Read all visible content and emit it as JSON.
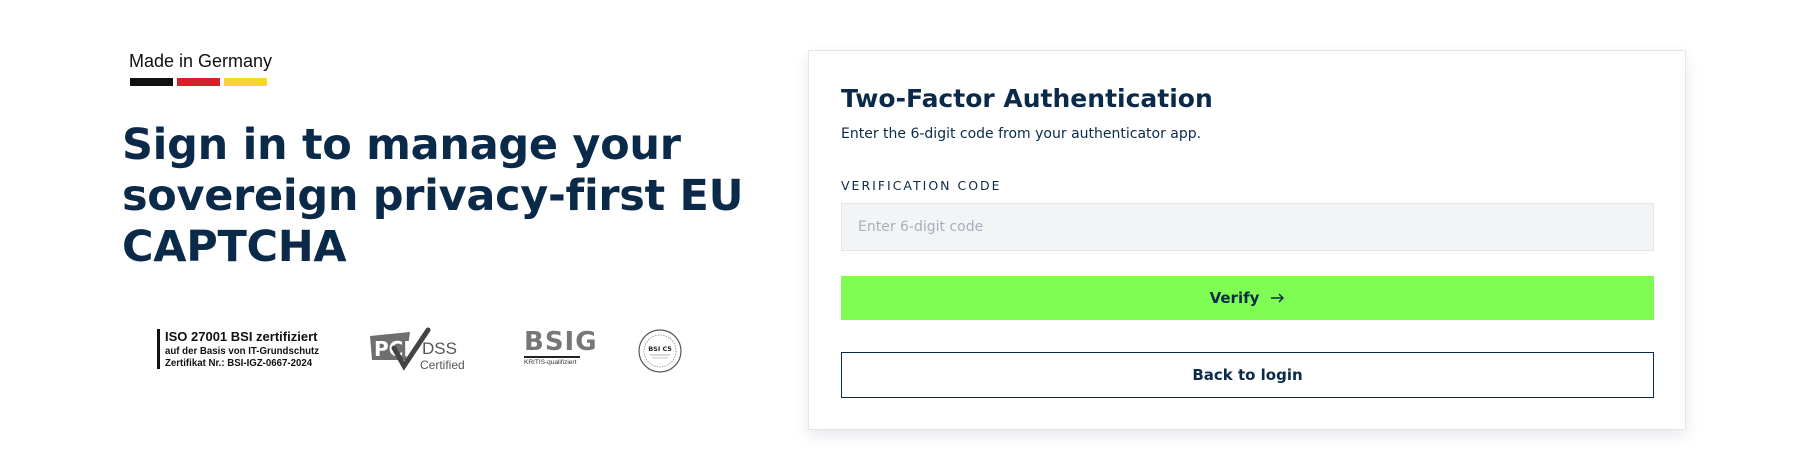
{
  "branding": {
    "made_in_label": "Made in Germany",
    "flag_colors": [
      "#111111",
      "#d2232a",
      "#f7d633"
    ]
  },
  "hero": {
    "headline": "Sign in to manage your sovereign privacy-first EU CAPTCHA"
  },
  "certifications": {
    "iso": {
      "line1": "ISO 27001 BSI zertifiziert",
      "line2": "auf der Basis von IT-Grundschutz",
      "line3": "Zertifikat Nr.: BSI-IGZ-0667-2024"
    },
    "pci": {
      "brand": "PCI",
      "dss": "DSS",
      "label": "Certified"
    },
    "bsig": {
      "letters": "BSIG",
      "sub": "KRITIS-qualifiziert"
    },
    "seal": {
      "label": "BSI C5"
    }
  },
  "card": {
    "title": "Two-Factor Authentication",
    "subtitle": "Enter the 6-digit code from your authenticator app.",
    "field_label": "VERIFICATION CODE",
    "code_value": "",
    "code_placeholder": "Enter 6-digit code",
    "verify_label": "Verify",
    "verify_icon": "arrow-right-icon",
    "back_label": "Back to login"
  },
  "colors": {
    "primary_navy": "#0b2a4a",
    "accent_green": "#7ffd52"
  }
}
